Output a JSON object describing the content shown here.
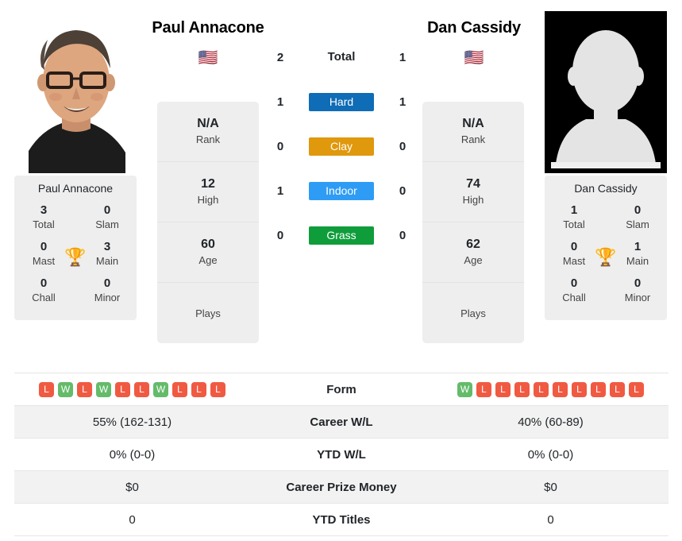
{
  "players": {
    "left": {
      "name": "Paul Annacone",
      "flag": "🇺🇸",
      "card_name": "Paul Annacone",
      "photo_kind": "portrait-photo",
      "vitals": [
        {
          "value": "N/A",
          "key": "Rank"
        },
        {
          "value": "12",
          "key": "High"
        },
        {
          "value": "60",
          "key": "Age"
        },
        {
          "value": "",
          "key": "Plays"
        }
      ],
      "titles": [
        {
          "value": "3",
          "key": "Total"
        },
        {
          "value": "0",
          "key": "Slam"
        },
        {
          "value": "0",
          "key": "Mast"
        },
        {
          "value": "3",
          "key": "Main"
        },
        {
          "value": "0",
          "key": "Chall"
        },
        {
          "value": "0",
          "key": "Minor"
        }
      ],
      "form": [
        "L",
        "W",
        "L",
        "W",
        "L",
        "L",
        "W",
        "L",
        "L",
        "L"
      ],
      "career_wl": "55% (162-131)",
      "ytd_wl": "0% (0-0)",
      "career_prize_money": "$0",
      "ytd_titles": "0"
    },
    "right": {
      "name": "Dan Cassidy",
      "flag": "🇺🇸",
      "card_name": "Dan Cassidy",
      "photo_kind": "placeholder-silhouette",
      "vitals": [
        {
          "value": "N/A",
          "key": "Rank"
        },
        {
          "value": "74",
          "key": "High"
        },
        {
          "value": "62",
          "key": "Age"
        },
        {
          "value": "",
          "key": "Plays"
        }
      ],
      "titles": [
        {
          "value": "1",
          "key": "Total"
        },
        {
          "value": "0",
          "key": "Slam"
        },
        {
          "value": "0",
          "key": "Mast"
        },
        {
          "value": "1",
          "key": "Main"
        },
        {
          "value": "0",
          "key": "Chall"
        },
        {
          "value": "0",
          "key": "Minor"
        }
      ],
      "form": [
        "W",
        "L",
        "L",
        "L",
        "L",
        "L",
        "L",
        "L",
        "L",
        "L"
      ],
      "career_wl": "40% (60-89)",
      "ytd_wl": "0% (0-0)",
      "career_prize_money": "$0",
      "ytd_titles": "0"
    }
  },
  "h2h": [
    {
      "left": "2",
      "label": "Total",
      "right": "1",
      "style": "plain"
    },
    {
      "left": "1",
      "label": "Hard",
      "right": "1",
      "style": "badge",
      "color": "#0f6cb6"
    },
    {
      "left": "0",
      "label": "Clay",
      "right": "0",
      "style": "badge",
      "color": "#e0980c"
    },
    {
      "left": "1",
      "label": "Indoor",
      "right": "0",
      "style": "badge",
      "color": "#2e9cf5"
    },
    {
      "left": "0",
      "label": "Grass",
      "right": "0",
      "style": "badge",
      "color": "#0f9d3c"
    }
  ],
  "comparison_rows": [
    {
      "label": "Form",
      "left": "",
      "right": "",
      "kind": "form"
    },
    {
      "label": "Career W/L",
      "left": "55% (162-131)",
      "right": "40% (60-89)",
      "kind": "text"
    },
    {
      "label": "YTD W/L",
      "left": "0% (0-0)",
      "right": "0% (0-0)",
      "kind": "text"
    },
    {
      "label": "Career Prize Money",
      "left": "$0",
      "right": "$0",
      "kind": "text"
    },
    {
      "label": "YTD Titles",
      "left": "0",
      "right": "0",
      "kind": "text"
    }
  ],
  "colors": {
    "hard": "#0f6cb6",
    "clay": "#e0980c",
    "indoor": "#2e9cf5",
    "grass": "#0f9d3c",
    "win": "#64bb6a",
    "loss": "#f05a42",
    "card_bg": "#eeeeee",
    "row_alt_bg": "#f2f2f2"
  },
  "icons": {
    "trophy": "🏆"
  }
}
